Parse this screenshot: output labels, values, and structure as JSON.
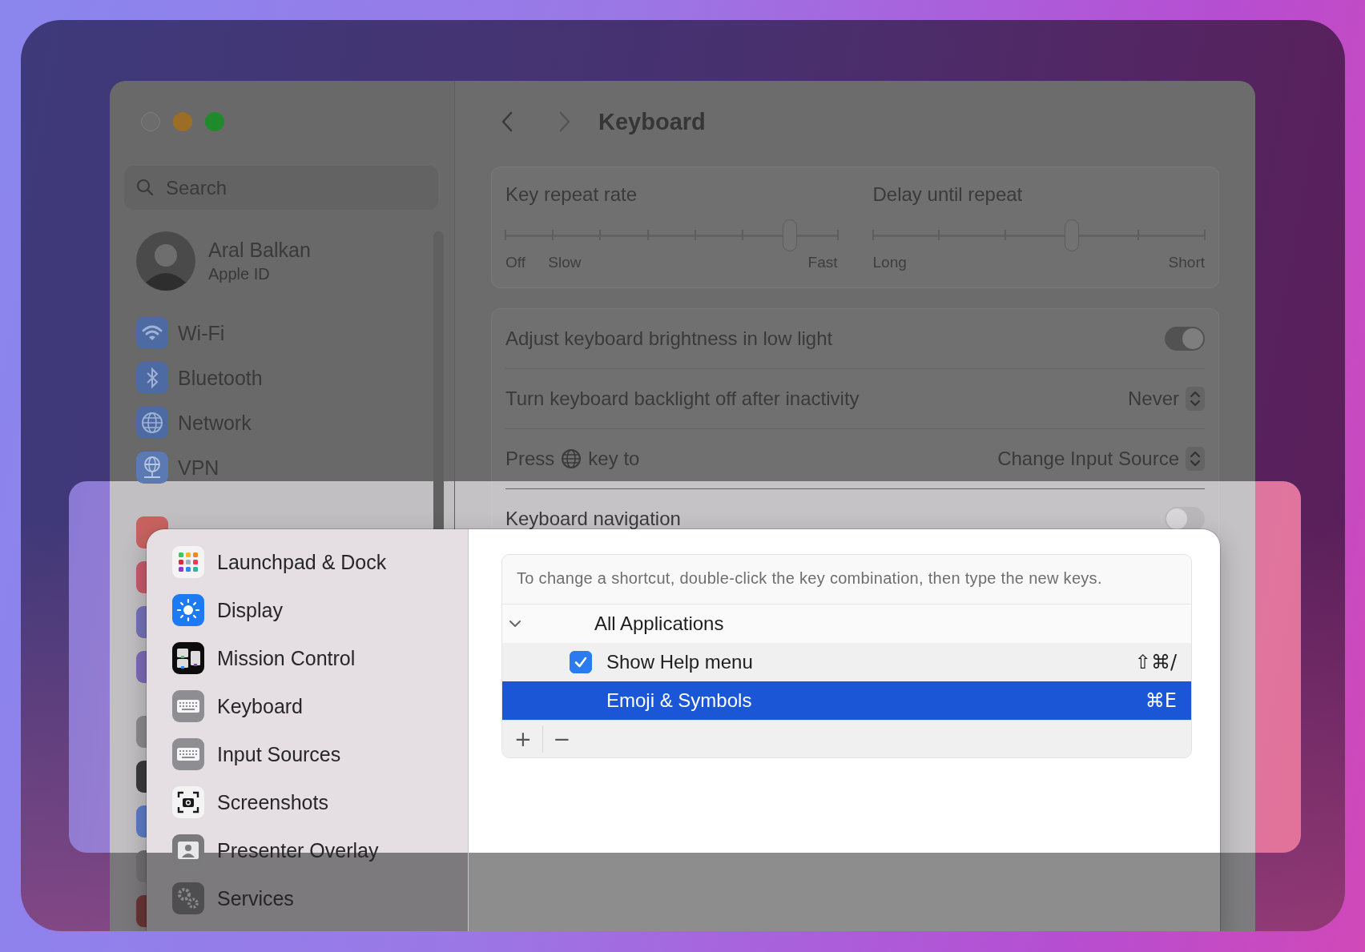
{
  "window": {
    "title": "Keyboard"
  },
  "sidebar": {
    "search": {
      "placeholder": "Search"
    },
    "account": {
      "name": "Aral Balkan",
      "subtitle": "Apple ID"
    },
    "groups": [
      {
        "items": [
          {
            "kind": "wifi",
            "label": "Wi-Fi",
            "selected": false
          },
          {
            "kind": "bluetooth",
            "label": "Bluetooth",
            "selected": false
          },
          {
            "kind": "network",
            "label": "Network",
            "selected": false
          },
          {
            "kind": "vpn",
            "label": "VPN",
            "selected": false
          }
        ]
      },
      {
        "items": [
          {
            "kind": "covered",
            "color": "#c8625f"
          },
          {
            "kind": "covered",
            "color": "#c85a6c"
          },
          {
            "kind": "covered",
            "color": "#7472b8"
          },
          {
            "kind": "covered",
            "color": "#7c6cb6"
          }
        ]
      },
      {
        "items": [
          {
            "kind": "covered",
            "color": "#8c8a8c"
          },
          {
            "kind": "covered",
            "color": "#3a3a3c"
          },
          {
            "kind": "covered",
            "color": "#5c7cc4"
          },
          {
            "kind": "covered",
            "color": "#6e6c6e"
          },
          {
            "kind": "covered",
            "color": "#6a3434"
          }
        ]
      }
    ]
  },
  "sliders": [
    {
      "kind": "rate",
      "title": "Key repeat rate",
      "level": 0.857,
      "labels": [
        "Off",
        "Slow",
        "Fast"
      ]
    },
    {
      "kind": "delay",
      "title": "Delay until repeat",
      "level": 0.6,
      "labels": [
        "Long",
        "Short"
      ]
    }
  ],
  "settings_rows": [
    {
      "kind": "toggle",
      "label": "Adjust keyboard brightness in low light",
      "on": true
    },
    {
      "kind": "popup",
      "label": "Turn keyboard backlight off after inactivity",
      "value": "Never"
    },
    {
      "kind": "globe-popup",
      "label_before": "Press",
      "label_after": "key to",
      "value": "Change Input Source"
    },
    {
      "kind": "toggle",
      "label": "Keyboard navigation",
      "on": false
    }
  ],
  "sheet": {
    "categories": [
      {
        "kind": "launchpad",
        "label": "Launchpad & Dock",
        "selected": false
      },
      {
        "kind": "display",
        "label": "Display",
        "selected": false
      },
      {
        "kind": "mission",
        "label": "Mission Control",
        "selected": false
      },
      {
        "kind": "keyboard",
        "label": "Keyboard",
        "selected": false
      },
      {
        "kind": "keyboard",
        "label": "Input Sources",
        "selected": false
      },
      {
        "kind": "screenshot",
        "label": "Screenshots",
        "selected": false
      },
      {
        "kind": "presenter",
        "label": "Presenter Overlay",
        "selected": false
      },
      {
        "kind": "services",
        "label": "Services",
        "selected": false
      }
    ],
    "hint": "To change a shortcut, double-click the key combination, then type the new keys.",
    "group": {
      "label": "All Applications",
      "expanded": true
    },
    "rows": [
      {
        "kind": "checkbox",
        "label": "Show Help menu",
        "keys": "⇧⌘/",
        "checked": true,
        "selected": false
      },
      {
        "kind": "plain",
        "label": "Emoji & Symbols",
        "keys": "⌘E",
        "selected": true
      }
    ],
    "buttons": [
      "+",
      "−"
    ]
  }
}
